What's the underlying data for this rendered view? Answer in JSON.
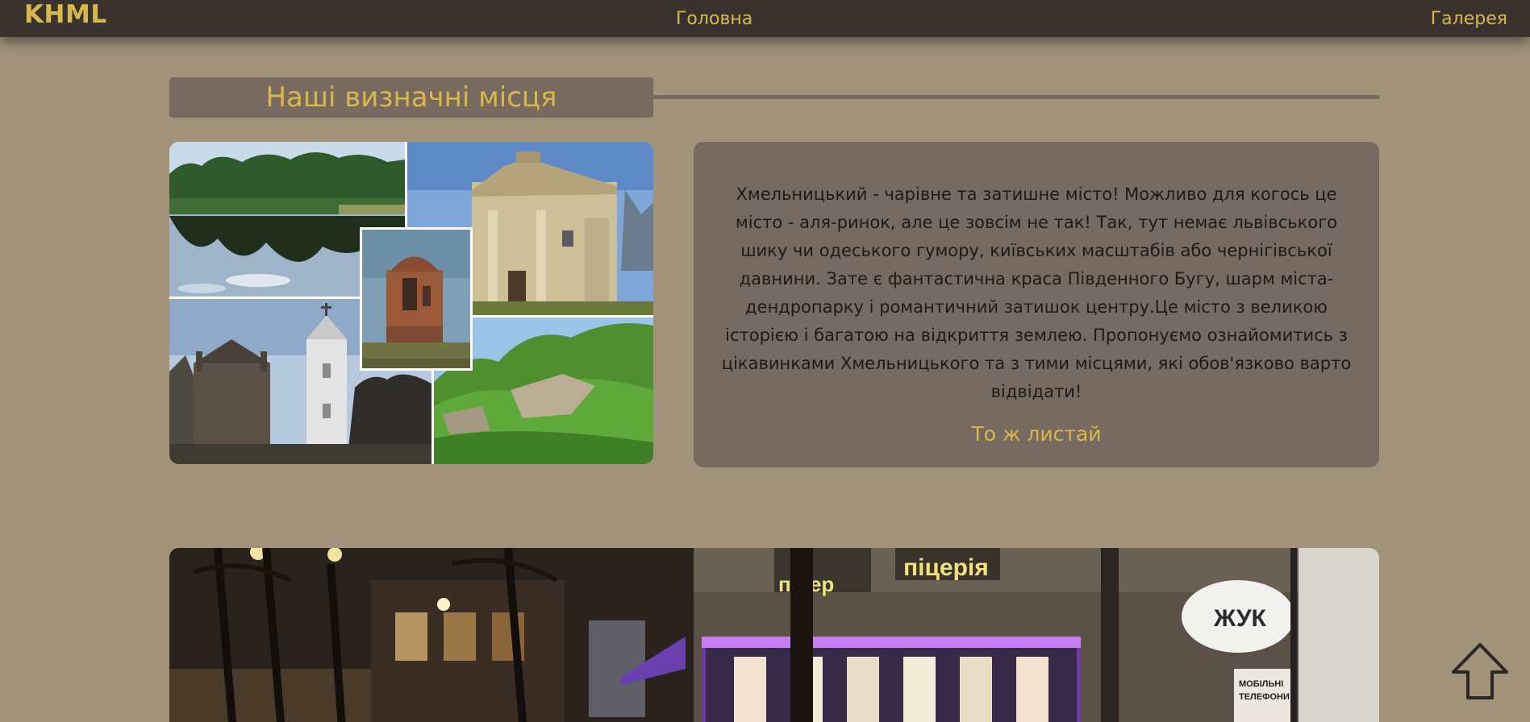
{
  "nav": {
    "logo": "KHML",
    "home": "Головна",
    "gallery": "Галерея"
  },
  "section": {
    "title": "Наші визначні місця"
  },
  "collage": {
    "photos": [
      "lake-photo",
      "church-top-photo",
      "chapel-photo",
      "church-bottom-photo",
      "cliffs-photo"
    ]
  },
  "info": {
    "text": "Хмельницький - чарівне та затишне місто! Можливо для когось це місто - аля-ринок, але це зовсім не так! Так, тут немає львівського шику чи одеського гумору, київських масштабів або чернігівської давнини. Зате є фантастична краса Південного Бугу, шарм міста-дендропарку і романтичний затишок центру.Це місто з великою історією і багатою на відкриття землею. Пропонуємо ознайомитись з цікавинками Хмельницького та з тими місцями, які обов'язково варто відвідати!",
    "link": "То ж листай"
  },
  "banner": {
    "signs": [
      "піцерія",
      "піцер",
      "ЖУК",
      "МОБІЛЬНІ",
      "ТЕЛЕФОНИ"
    ]
  },
  "icons": {
    "scroll_top": "arrow-up-icon"
  },
  "colors": {
    "background": "#a1937a",
    "navbar": "#3a332d",
    "accent": "#d8b84a",
    "card": "#776a60"
  }
}
